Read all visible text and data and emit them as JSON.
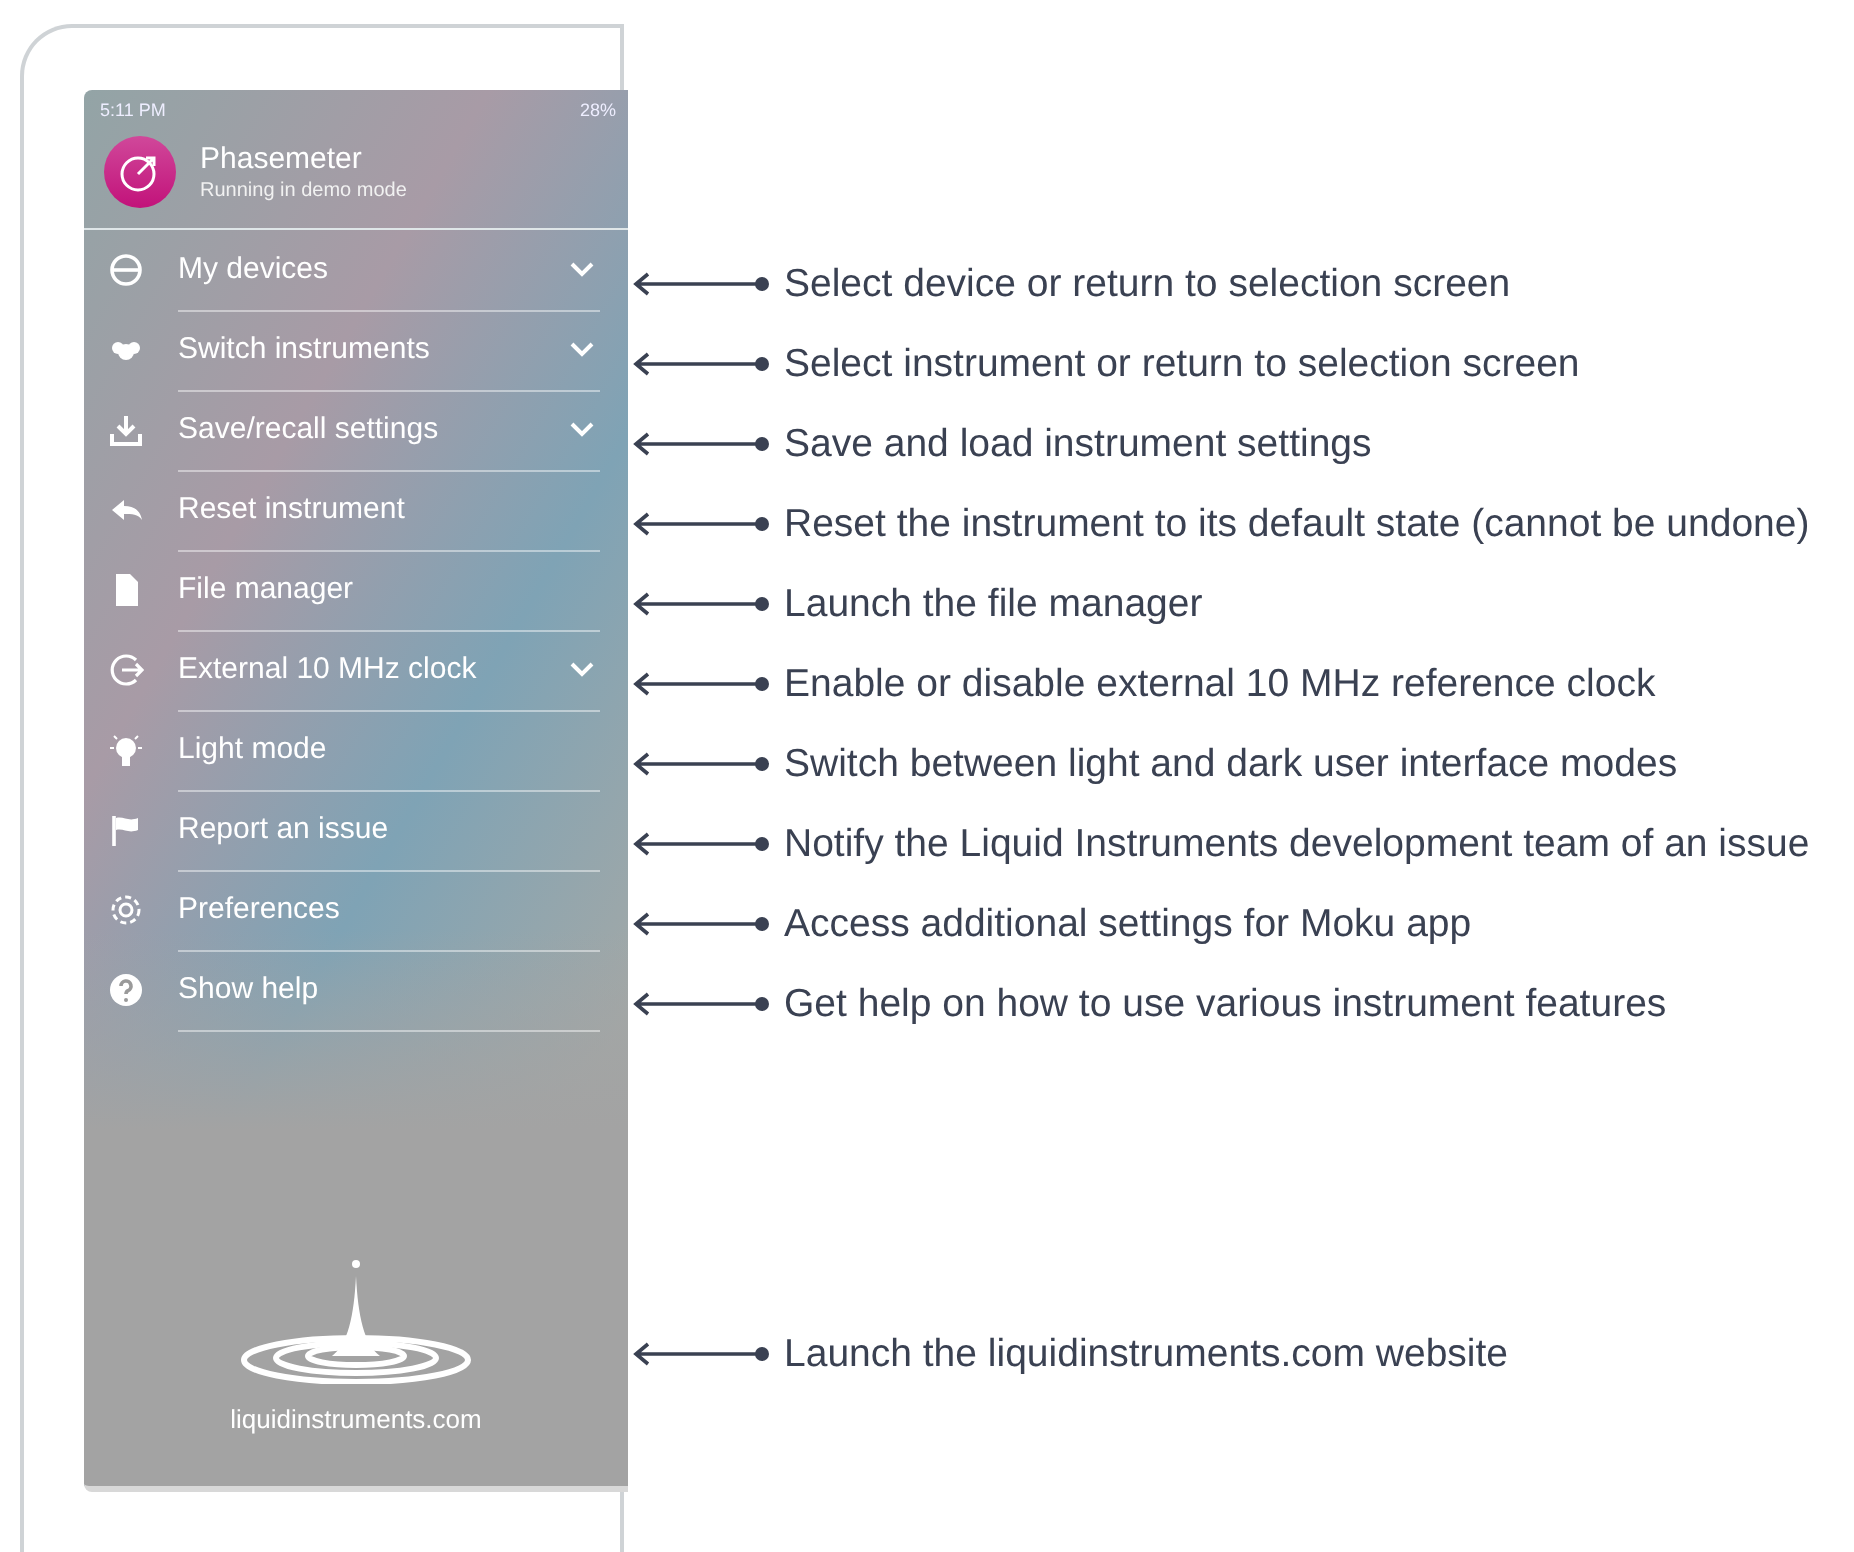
{
  "status_bar": {
    "time": "5:11 PM",
    "battery": "28%"
  },
  "app": {
    "title": "Phasemeter",
    "subtitle": "Running in demo mode"
  },
  "menu": [
    {
      "label": "My devices",
      "kind": "devices",
      "has_submenu": true,
      "note": "Select device or return to selection screen"
    },
    {
      "label": "Switch instruments",
      "kind": "instruments",
      "has_submenu": true,
      "note": "Select instrument or return to selection screen"
    },
    {
      "label": "Save/recall settings",
      "kind": "download",
      "has_submenu": true,
      "note": "Save and load instrument settings"
    },
    {
      "label": "Reset instrument",
      "kind": "reset",
      "has_submenu": false,
      "note": "Reset the instrument to its default state (cannot be undone)"
    },
    {
      "label": "File manager",
      "kind": "file",
      "has_submenu": false,
      "note": "Launch the file manager"
    },
    {
      "label": "External 10 MHz clock",
      "kind": "clock",
      "has_submenu": true,
      "note": "Enable or disable external 10 MHz reference clock"
    },
    {
      "label": "Light mode",
      "kind": "bulb",
      "has_submenu": false,
      "note": "Switch between light and dark user interface modes"
    },
    {
      "label": "Report an issue",
      "kind": "flag",
      "has_submenu": false,
      "note": "Notify the Liquid Instruments development team of an issue"
    },
    {
      "label": "Preferences",
      "kind": "gear",
      "has_submenu": false,
      "note": "Access additional settings for Moku app"
    },
    {
      "label": "Show help",
      "kind": "help",
      "has_submenu": false,
      "note": "Get help on how to use various instrument features"
    }
  ],
  "footer": {
    "website": "liquidinstruments.com",
    "note": "Launch the liquidinstruments.com website"
  }
}
